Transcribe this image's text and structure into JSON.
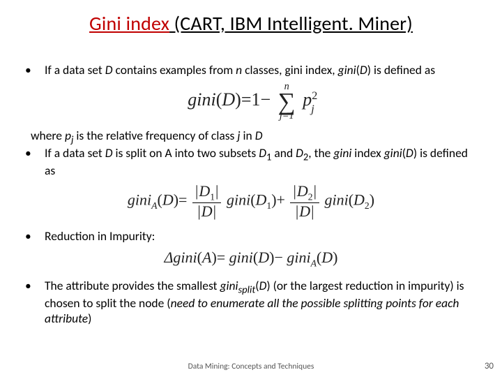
{
  "title": {
    "accent": "Gini index",
    "rest": " (CART, IBM Intelligent. Miner)"
  },
  "bullets": {
    "b1_pre": "If a data set ",
    "b1_D": "D",
    "b1_mid1": " contains examples from ",
    "b1_n": "n",
    "b1_mid2": " classes, gini index, ",
    "b1_giniD": "gini",
    "b1_paren": "(",
    "b1_D2": "D",
    "b1_close": ") is defined as",
    "where_pre": "where ",
    "where_p": "p",
    "where_j": "j",
    "where_mid": " is the relative frequency of class ",
    "where_j2": "j",
    "where_post": " in ",
    "where_D": "D",
    "b2_pre": "If a data set ",
    "b2_D": "D",
    "b2_mid1": "  is split on A into two subsets ",
    "b2_D1": "D",
    "b2_s1": "1",
    "b2_and": " and ",
    "b2_D2": "D",
    "b2_s2": "2",
    "b2_mid2": ", the ",
    "b2_gini": "gini",
    "b2_idx": " index ",
    "b2_giniD": "gini",
    "b2_paren": "(",
    "b2_D3": "D",
    "b2_close": ") is defined as",
    "b3": "Reduction in Impurity:",
    "b4_pre": "The attribute provides the smallest ",
    "b4_gini": "gini",
    "b4_split": "split",
    "b4_paren": "(",
    "b4_D": "D",
    "b4_close": ") (or the largest reduction in impurity) is chosen to split the node (",
    "b4_em": "need to enumerate all the possible splitting points for each attribute",
    "b4_post": ")"
  },
  "eq": {
    "e1_gini": "gini",
    "e1_D": "D",
    "e1_eq": "=1−",
    "e1_sumtop": "n",
    "e1_sumbot": "j=1",
    "e1_p": "p",
    "e1_j": "j",
    "e1_two": "2",
    "e2_gini": "gini",
    "e2_A": "A",
    "e2_D": "D",
    "e2_D1": "D",
    "e2_s1": "1",
    "e2_D2": "D",
    "e2_s2": "2",
    "e3_delta": "Δgini",
    "e3_A": "A",
    "e3_gini": "gini",
    "e3_D": "D",
    "e3_giniA": "gini",
    "e3_sA": "A"
  },
  "footer": "Data Mining: Concepts and Techniques",
  "pagenum": "30"
}
